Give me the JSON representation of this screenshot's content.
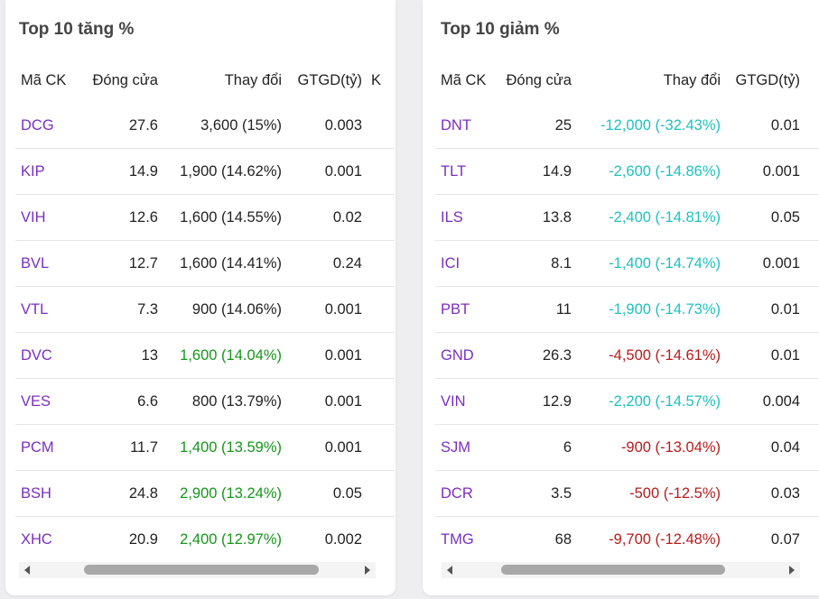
{
  "colors": {
    "ceiling": "#e23ee0",
    "up": "#16961a",
    "floor": "#1fc0c0",
    "down": "#b71c1c",
    "symbol": "#7a2fc2"
  },
  "gainers": {
    "title": "Top 10 tăng %",
    "columns": [
      "Mã CK",
      "Đóng cửa",
      "Thay đổi",
      "GTGD(tỷ)",
      "K"
    ],
    "rows": [
      {
        "symbol": "DCG",
        "close": "27.6",
        "change": "3,600 (15%)",
        "value": "0.003",
        "status": "ceiling"
      },
      {
        "symbol": "KIP",
        "close": "14.9",
        "change": "1,900 (14.62%)",
        "value": "0.001",
        "status": "ceiling"
      },
      {
        "symbol": "VIH",
        "close": "12.6",
        "change": "1,600 (14.55%)",
        "value": "0.02",
        "status": "ceiling"
      },
      {
        "symbol": "BVL",
        "close": "12.7",
        "change": "1,600 (14.41%)",
        "value": "0.24",
        "status": "ceiling"
      },
      {
        "symbol": "VTL",
        "close": "7.3",
        "change": "900 (14.06%)",
        "value": "0.001",
        "status": "ceiling"
      },
      {
        "symbol": "DVC",
        "close": "13",
        "change": "1,600 (14.04%)",
        "value": "0.001",
        "status": "up"
      },
      {
        "symbol": "VES",
        "close": "6.6",
        "change": "800 (13.79%)",
        "value": "0.001",
        "status": "ceiling"
      },
      {
        "symbol": "PCM",
        "close": "11.7",
        "change": "1,400 (13.59%)",
        "value": "0.001",
        "status": "up"
      },
      {
        "symbol": "BSH",
        "close": "24.8",
        "change": "2,900 (13.24%)",
        "value": "0.05",
        "status": "up"
      },
      {
        "symbol": "XHC",
        "close": "20.9",
        "change": "2,400 (12.97%)",
        "value": "0.002",
        "status": "up"
      }
    ]
  },
  "losers": {
    "title": "Top 10 giảm %",
    "columns": [
      "Mã CK",
      "Đóng cửa",
      "Thay đổi",
      "GTGD(tỷ)"
    ],
    "rows": [
      {
        "symbol": "DNT",
        "close": "25",
        "change": "-12,000 (-32.43%)",
        "value": "0.01",
        "status": "floor"
      },
      {
        "symbol": "TLT",
        "close": "14.9",
        "change": "-2,600 (-14.86%)",
        "value": "0.001",
        "status": "floor"
      },
      {
        "symbol": "ILS",
        "close": "13.8",
        "change": "-2,400 (-14.81%)",
        "value": "0.05",
        "status": "floor"
      },
      {
        "symbol": "ICI",
        "close": "8.1",
        "change": "-1,400 (-14.74%)",
        "value": "0.001",
        "status": "floor"
      },
      {
        "symbol": "PBT",
        "close": "11",
        "change": "-1,900 (-14.73%)",
        "value": "0.01",
        "status": "floor"
      },
      {
        "symbol": "GND",
        "close": "26.3",
        "change": "-4,500 (-14.61%)",
        "value": "0.01",
        "status": "down"
      },
      {
        "symbol": "VIN",
        "close": "12.9",
        "change": "-2,200 (-14.57%)",
        "value": "0.004",
        "status": "floor"
      },
      {
        "symbol": "SJM",
        "close": "6",
        "change": "-900 (-13.04%)",
        "value": "0.04",
        "status": "down"
      },
      {
        "symbol": "DCR",
        "close": "3.5",
        "change": "-500 (-12.5%)",
        "value": "0.03",
        "status": "down"
      },
      {
        "symbol": "TMG",
        "close": "68",
        "change": "-9,700 (-12.48%)",
        "value": "0.07",
        "status": "down"
      }
    ]
  }
}
